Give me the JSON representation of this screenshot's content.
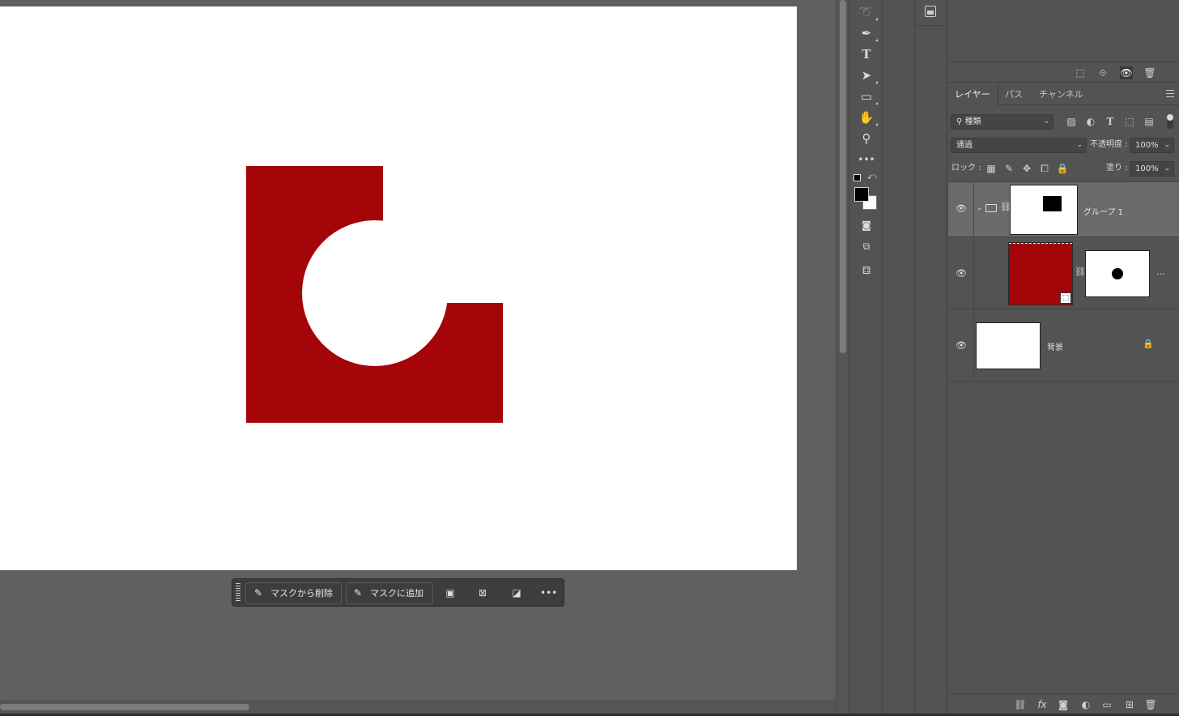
{
  "canvas": {
    "artwork_color": "#a30509",
    "background": "#ffffff"
  },
  "contextual_taskbar": {
    "subtract_label": "マスクから削除",
    "add_label": "マスクに追加",
    "more_label": "•••"
  },
  "toolbar": {
    "tools": [
      "lasso-icon",
      "pen-icon",
      "type-icon",
      "path-selection-icon",
      "rectangle-icon",
      "hand-icon",
      "zoom-icon",
      "more-tools-icon"
    ],
    "type_glyph": "T",
    "more_glyph": "•••"
  },
  "layers_panel": {
    "tabs": [
      "レイヤー",
      "パス",
      "チャンネル"
    ],
    "filter_label": "種類",
    "blend_mode": "通過",
    "opacity_label": "不透明度 :",
    "opacity_value": "100%",
    "lock_label": "ロック :",
    "fill_label": "塗り :",
    "fill_value": "100%",
    "layers": [
      {
        "name": "グループ 1",
        "type": "group",
        "mask": "rectangle"
      },
      {
        "name": "",
        "type": "fill",
        "color": "#a30509",
        "mask": "circle",
        "more": "..."
      },
      {
        "name": "背景",
        "type": "background",
        "locked": true
      }
    ]
  }
}
